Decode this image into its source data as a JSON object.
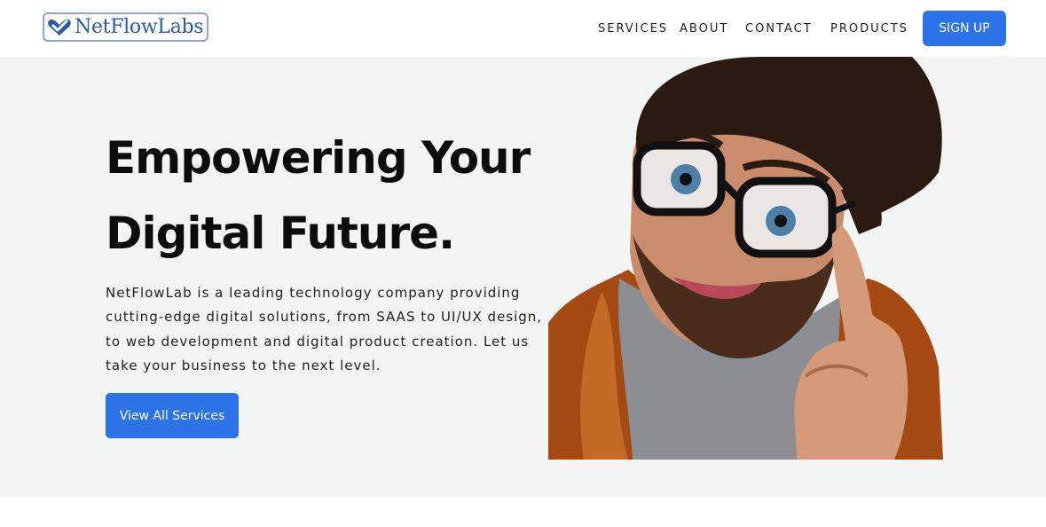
{
  "header": {
    "logo_text": "NetFlowLabs",
    "nav": {
      "services": "SERVICES",
      "about": "ABOUT",
      "contact": "CONTACT",
      "products": "PRODUCTS"
    },
    "signup_label": "SIGN UP"
  },
  "hero": {
    "headline_line1": "Empowering Your",
    "headline_line2": "Digital Future.",
    "description": "NetFlowLab is a leading technology company providing cutting-edge digital solutions, from SAAS to UI/UX design, to web development and digital product creation. Let us take your business to the next level.",
    "cta_label": "View All Services"
  },
  "colors": {
    "accent": "#2b73e6",
    "hero_background": "#f2f5f4",
    "logo_blue": "#2d5aa6"
  },
  "icons": {
    "logo_mark": "heart-check-icon"
  }
}
